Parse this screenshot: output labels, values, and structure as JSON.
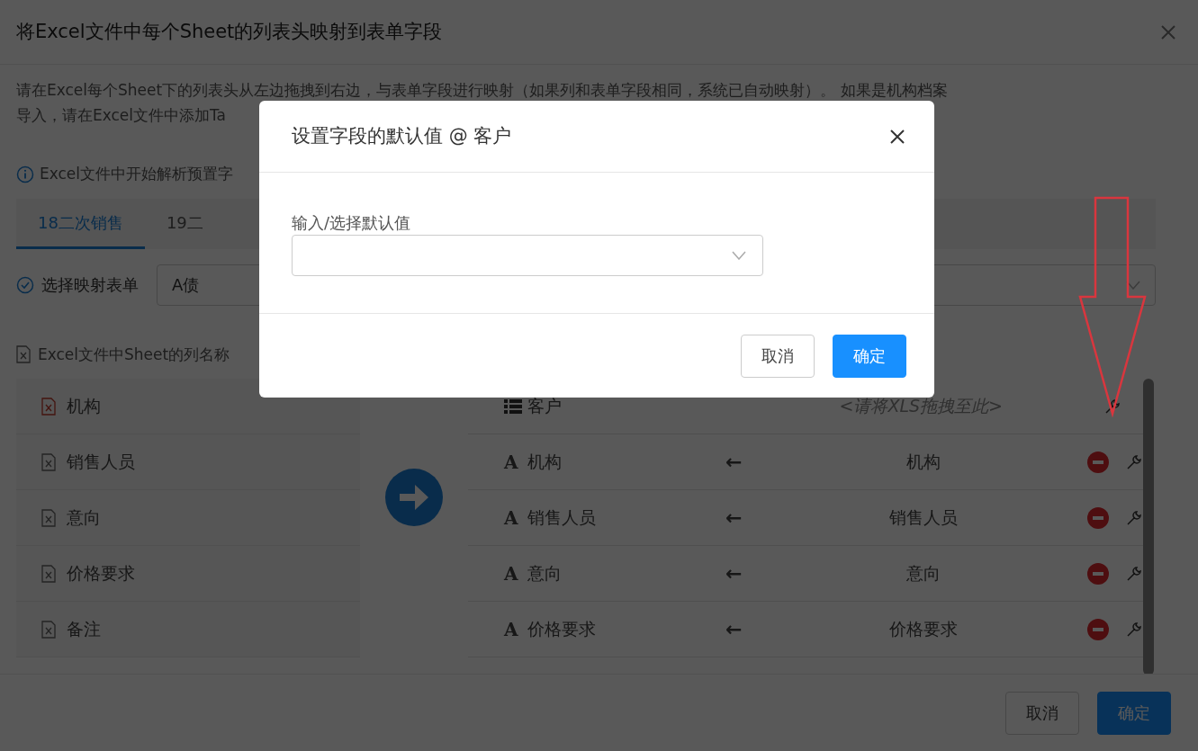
{
  "dialog": {
    "title": "将Excel文件中每个Sheet的列表头映射到表单字段"
  },
  "description": [
    "请在Excel每个Sheet下的列表头从左边拖拽到右边，与表单字段进行映射（如果列和表单字段相同，系统已自动映射）。 如果是机构档案",
    "导入，请在Excel文件中添加Ta"
  ],
  "notice": "Excel文件中开始解析预置字",
  "tabs": [
    {
      "label": "18二次销售",
      "selected": true
    },
    {
      "label": "19二",
      "selected": false
    }
  ],
  "form_select": {
    "label": "选择映射表单",
    "value": "A债"
  },
  "excel_columns": {
    "header": "Excel文件中Sheet的列名称",
    "items": [
      {
        "name": "机构",
        "active": true
      },
      {
        "name": "销售人员",
        "active": false
      },
      {
        "name": "意向",
        "active": false
      },
      {
        "name": "价格要求",
        "active": false
      },
      {
        "name": "备注",
        "active": false
      }
    ]
  },
  "form_fields": [
    {
      "kind": "list",
      "name": "客户",
      "placeholder": "<请将XLS拖拽至此>"
    },
    {
      "kind": "text",
      "icon": "A",
      "name": "机构",
      "arrow": "←",
      "mapped": "机构"
    },
    {
      "kind": "text",
      "icon": "A",
      "name": "销售人员",
      "arrow": "←",
      "mapped": "销售人员"
    },
    {
      "kind": "text",
      "icon": "A",
      "name": "意向",
      "arrow": "←",
      "mapped": "意向"
    },
    {
      "kind": "text",
      "icon": "A",
      "name": "价格要求",
      "arrow": "←",
      "mapped": "价格要求"
    }
  ],
  "footer_buttons": [
    {
      "label": "取消",
      "kind": "secondary"
    },
    {
      "label": "确定",
      "kind": "primary"
    }
  ],
  "modal": {
    "title": "设置字段的默认值 @ 客户",
    "field_label": "输入/选择默认值",
    "buttons": [
      {
        "label": "取消",
        "kind": "secondary"
      },
      {
        "label": "确定",
        "kind": "primary"
      }
    ]
  }
}
